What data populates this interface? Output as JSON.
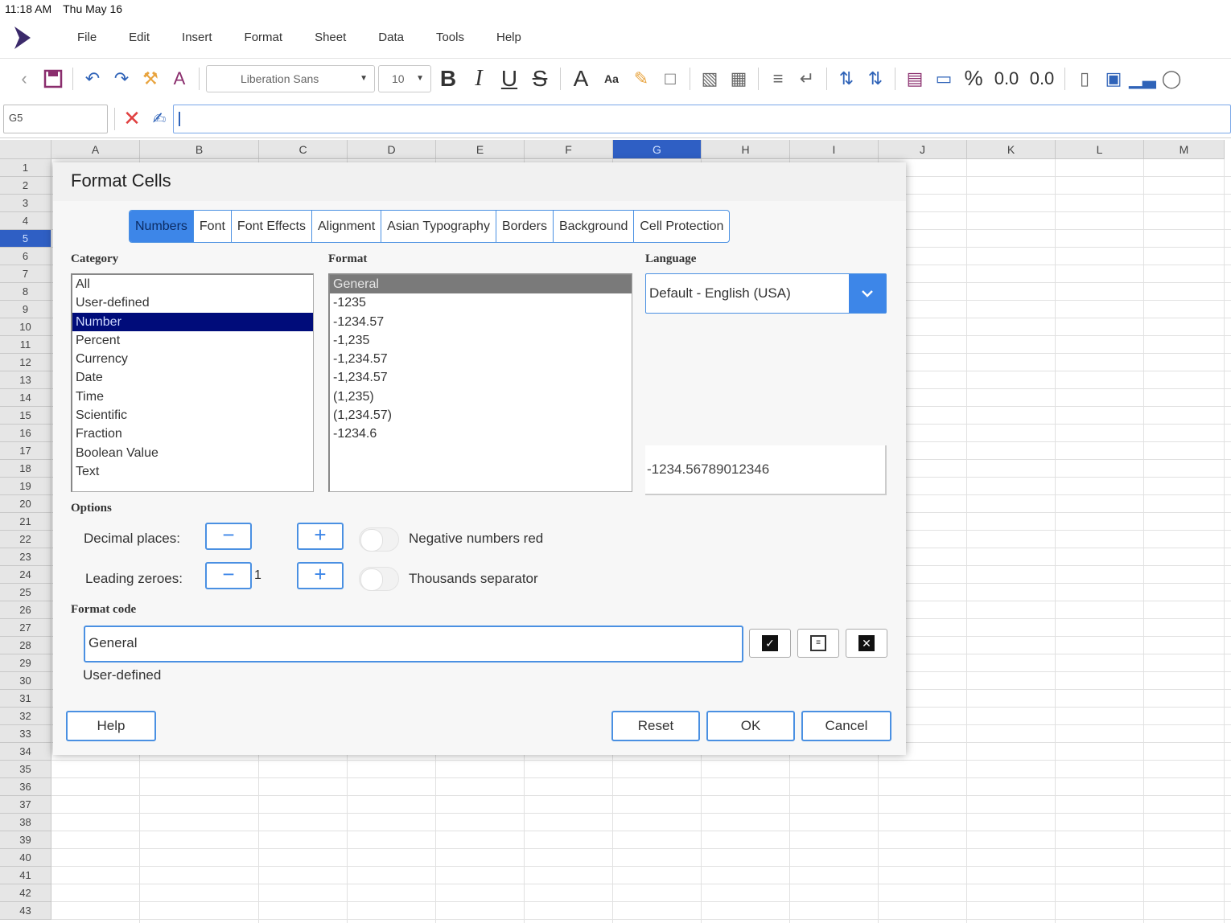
{
  "status": {
    "time": "11:18 AM",
    "date": "Thu May 16"
  },
  "menu": [
    "File",
    "Edit",
    "Insert",
    "Format",
    "Sheet",
    "Data",
    "Tools",
    "Help"
  ],
  "toolbar": {
    "font_name": "Liberation Sans",
    "font_size": "10",
    "bold_label": "B",
    "italic_label": "I",
    "underline_label": "U",
    "strike_label": "S",
    "font_color_label": "A",
    "case_label": "Aa",
    "percent_label": "%",
    "add_decimal_label": "0.0",
    "del_decimal_label": "0.0"
  },
  "formula": {
    "cell_ref": "G5",
    "value": ""
  },
  "columns": [
    "A",
    "B",
    "C",
    "D",
    "E",
    "F",
    "G",
    "H",
    "I",
    "J",
    "K",
    "L",
    "M"
  ],
  "active_column": "G",
  "rows": [
    "1",
    "2",
    "3",
    "4",
    "5",
    "6",
    "7",
    "8",
    "9",
    "10",
    "11",
    "12",
    "13",
    "14",
    "15",
    "16",
    "17",
    "18",
    "19",
    "20",
    "21",
    "22",
    "23",
    "24",
    "25",
    "26",
    "27",
    "28",
    "29",
    "30",
    "31",
    "32",
    "33",
    "34",
    "35",
    "36",
    "37",
    "38",
    "39",
    "40",
    "41",
    "42",
    "43"
  ],
  "active_row": "5",
  "dialog": {
    "title": "Format Cells",
    "tabs": [
      "Numbers",
      "Font",
      "Font Effects",
      "Alignment",
      "Asian Typography",
      "Borders",
      "Background",
      "Cell Protection"
    ],
    "active_tab": "Numbers",
    "category_label": "Category",
    "categories": [
      "All",
      "User-defined",
      "Number",
      "Percent",
      "Currency",
      "Date",
      "Time",
      "Scientific",
      "Fraction",
      "Boolean Value",
      "Text"
    ],
    "selected_category": "Number",
    "format_label": "Format",
    "formats": [
      "General",
      "-1235",
      "-1234.57",
      "-1,235",
      "-1,234.57",
      "-1,234.57",
      "(1,235)",
      "(1,234.57)",
      "-1234.6"
    ],
    "selected_format": "General",
    "language_label": "Language",
    "language_value": "Default - English (USA)",
    "preview_value": "-1234.56789012346",
    "options_label": "Options",
    "decimal_places_label": "Decimal places:",
    "decimal_places_value": "",
    "leading_zeroes_label": "Leading zeroes:",
    "leading_zeroes_value": "1",
    "negative_red_label": "Negative numbers red",
    "thousands_sep_label": "Thousands separator",
    "format_code_label": "Format code",
    "format_code_value": "General",
    "format_type_text": "User-defined",
    "help_label": "Help",
    "reset_label": "Reset",
    "ok_label": "OK",
    "cancel_label": "Cancel"
  },
  "colors": {
    "accent": "#3d86e8",
    "selection_dark": "#000c7a",
    "header_active": "#2f5fc4"
  }
}
